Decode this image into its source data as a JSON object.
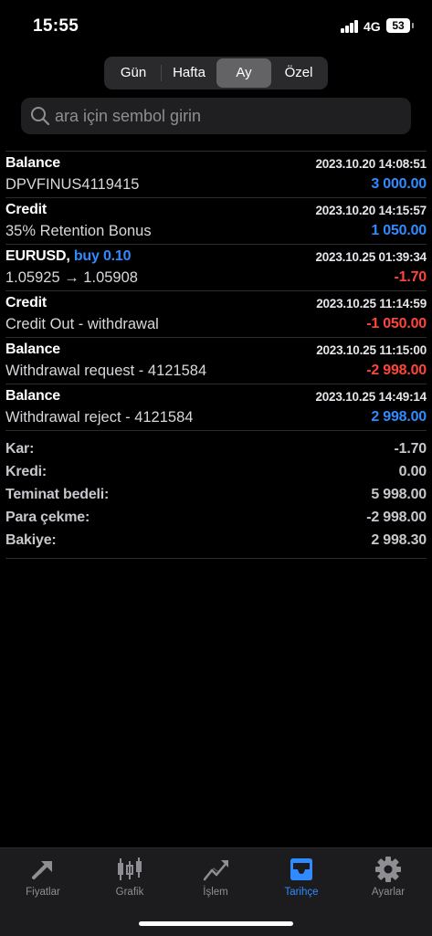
{
  "status": {
    "time": "15:55",
    "network": "4G",
    "battery": "53"
  },
  "segments": [
    {
      "label": "Gün",
      "active": false
    },
    {
      "label": "Hafta",
      "active": false
    },
    {
      "label": "Ay",
      "active": true
    },
    {
      "label": "Özel",
      "active": false
    }
  ],
  "search": {
    "placeholder": "ara için sembol girin"
  },
  "rows": [
    {
      "title": "Balance",
      "side": "",
      "date": "2023.10.20 14:08:51",
      "sub": "DPVFINUS4119415",
      "amount": "3 000.00",
      "tone": "pos"
    },
    {
      "title": "Credit",
      "side": "",
      "date": "2023.10.20 14:15:57",
      "sub": "35% Retention Bonus",
      "amount": "1 050.00",
      "tone": "pos"
    },
    {
      "title": "EURUSD,",
      "side": "buy 0.10",
      "date": "2023.10.25 01:39:34",
      "sub": "1.05925 → 1.05908",
      "amount": "-1.70",
      "tone": "neg"
    },
    {
      "title": "Credit",
      "side": "",
      "date": "2023.10.25 11:14:59",
      "sub": "Credit Out - withdrawal",
      "amount": "-1 050.00",
      "tone": "neg"
    },
    {
      "title": "Balance",
      "side": "",
      "date": "2023.10.25 11:15:00",
      "sub": "Withdrawal request - 4121584",
      "amount": "-2 998.00",
      "tone": "neg"
    },
    {
      "title": "Balance",
      "side": "",
      "date": "2023.10.25 14:49:14",
      "sub": "Withdrawal reject - 4121584",
      "amount": "2 998.00",
      "tone": "pos"
    }
  ],
  "summary": {
    "kar": {
      "label": "Kar:",
      "value": "-1.70"
    },
    "kredi": {
      "label": "Kredi:",
      "value": "0.00"
    },
    "teminat": {
      "label": "Teminat bedeli:",
      "value": "5 998.00"
    },
    "para": {
      "label": "Para çekme:",
      "value": "-2 998.00"
    },
    "bakiye": {
      "label": "Bakiye:",
      "value": "2 998.30"
    }
  },
  "tabs": {
    "fiyatlar": {
      "label": "Fiyatlar",
      "icon": "arrows-icon"
    },
    "grafik": {
      "label": "Grafik",
      "icon": "candles-icon"
    },
    "islem": {
      "label": "İşlem",
      "icon": "trend-icon"
    },
    "tarihce": {
      "label": "Tarihçe",
      "icon": "inbox-icon",
      "active": true
    },
    "ayarlar": {
      "label": "Ayarlar",
      "icon": "gear-icon"
    }
  },
  "colors": {
    "accent": "#2f8bff",
    "negative": "#ff453a",
    "background": "#000000"
  }
}
